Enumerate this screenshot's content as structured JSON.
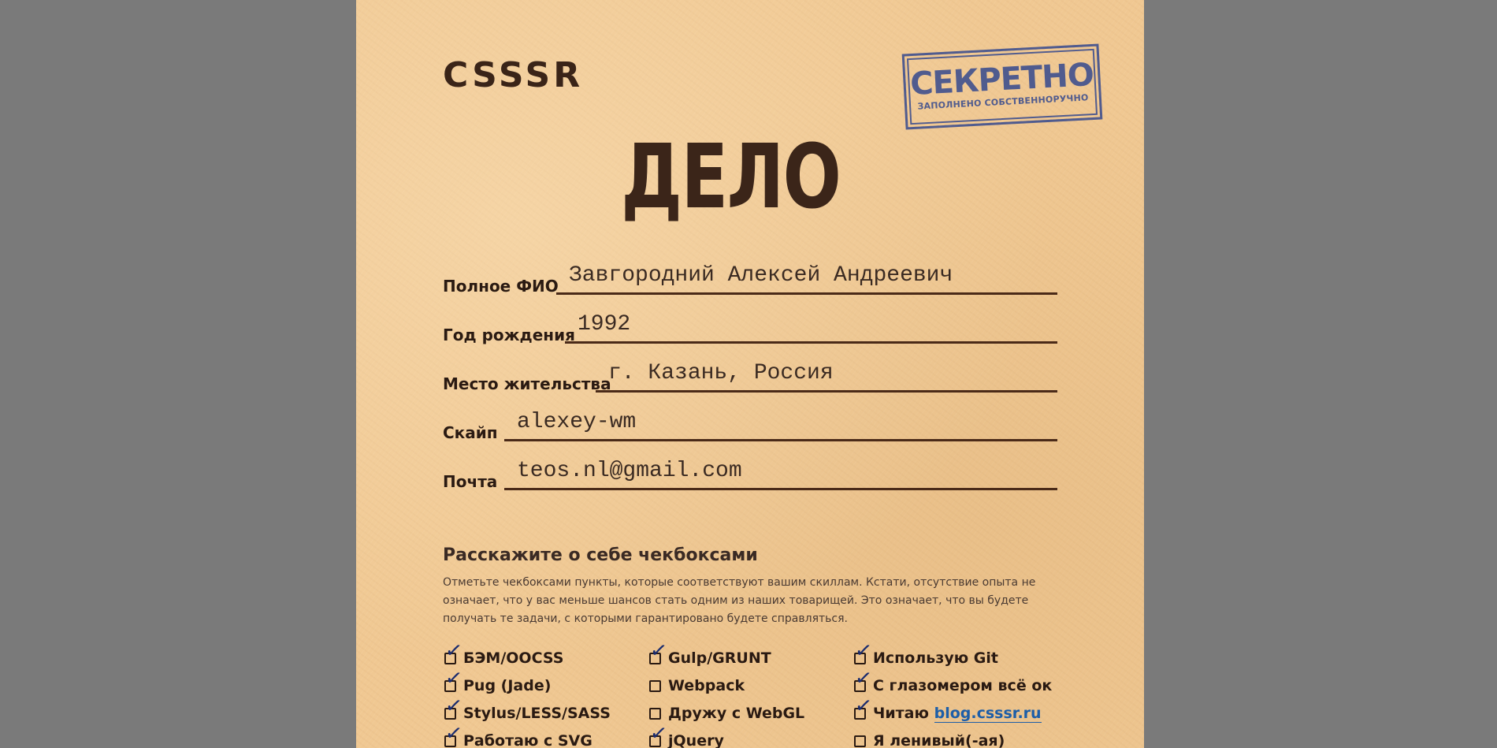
{
  "logo": "CSSSR",
  "stamp": {
    "title": "СЕКРЕТНО",
    "subtitle": "ЗАПОЛНЕНО СОБСТВЕННОРУЧНО"
  },
  "heading": "ДЕЛО",
  "form": {
    "name_label": "Полное ФИО",
    "name_value": "Завгородний Алексей Андреевич",
    "year_label": "Год рождения",
    "year_value": "1992",
    "city_label": "Место жительства",
    "city_value": "г. Казань, Россия",
    "skype_label": "Скайп",
    "skype_value": "alexey-wm",
    "email_label": "Почта",
    "email_value": "teos.nl@gmail.com"
  },
  "skills": {
    "title": "Расскажите о себе чекбоксами",
    "description": "Отметьте чекбоксами пункты, которые соответствуют вашим скиллам. Кстати, отсутствие опыта не означает, что у вас меньше шансов стать одним из наших товарищей. Это означает, что вы будете получать те задачи, с которыми гарантировано будете справляться.",
    "col1": [
      {
        "label": "БЭМ/OOCSS",
        "checked": true
      },
      {
        "label": "Pug (Jade)",
        "checked": true
      },
      {
        "label": "Stylus/LESS/SASS",
        "checked": true
      },
      {
        "label": "Работаю с SVG",
        "checked": true
      }
    ],
    "col2": [
      {
        "label": "Gulp/GRUNT",
        "checked": true
      },
      {
        "label": "Webpack",
        "checked": false
      },
      {
        "label": "Дружу с WebGL",
        "checked": false
      },
      {
        "label": "jQuery",
        "checked": true
      }
    ],
    "col3": [
      {
        "label": "Использую Git",
        "checked": true
      },
      {
        "label": "С глазомером всё ок",
        "checked": true
      },
      {
        "label": "Читаю",
        "link": "blog.csssr.ru",
        "checked": true
      },
      {
        "label": "Я ленивый(-ая)",
        "checked": false
      }
    ],
    "tick_glyph": "✓"
  },
  "colors": {
    "background": "#7a7a7a",
    "paper": "#f0c892",
    "stamp": "#3b4d8e",
    "ink": "#2a1a12",
    "link": "#1d5ea8",
    "tick": "#1a2b6e"
  }
}
